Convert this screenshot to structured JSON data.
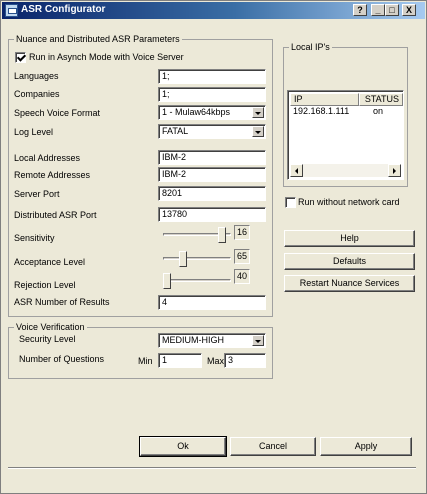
{
  "window": {
    "title": "ASR Configurator"
  },
  "title_buttons": {
    "help": "?",
    "minimize": "_",
    "maximize": "□",
    "close": "X"
  },
  "nuance_group": {
    "title": "Nuance and Distributed ASR Parameters",
    "async_label": "Run in Asynch Mode with Voice Server",
    "async_checked": true,
    "languages_label": "Languages",
    "languages_value": "1;",
    "companies_label": "Companies",
    "companies_value": "1;",
    "speech_format_label": "Speech Voice Format",
    "speech_format_value": "1 - Mulaw64kbps",
    "log_level_label": "Log Level",
    "log_level_value": "FATAL",
    "local_addresses_label": "Local Addresses",
    "local_addresses_value": "IBM-2",
    "remote_addresses_label": "Remote Addresses",
    "remote_addresses_value": "IBM-2",
    "server_port_label": "Server Port",
    "server_port_value": "8201",
    "distributed_port_label": "Distributed ASR Port",
    "distributed_port_value": "13780",
    "sensitivity_label": "Sensitivity",
    "sensitivity_value": "16",
    "acceptance_label": "Acceptance Level",
    "acceptance_value": "65",
    "rejection_label": "Rejection Level",
    "rejection_value": "40",
    "results_label": "ASR Number of Results",
    "results_value": "4"
  },
  "voice_group": {
    "title": "Voice Verification",
    "security_label": "Security Level",
    "security_value": "MEDIUM-HIGH",
    "questions_label": "Number of Questions",
    "min_label": "Min",
    "min_value": "1",
    "max_label": "Max",
    "max_value": "3"
  },
  "local_ips": {
    "title": "Local IP's",
    "columns": [
      "IP",
      "STATUS"
    ],
    "rows": [
      {
        "ip": "192.168.1.111",
        "status": "on"
      }
    ]
  },
  "run_without_network": {
    "label": "Run without network card",
    "checked": false
  },
  "buttons": {
    "help": "Help",
    "defaults": "Defaults",
    "restart": "Restart Nuance Services",
    "ok": "Ok",
    "cancel": "Cancel",
    "apply": "Apply"
  }
}
